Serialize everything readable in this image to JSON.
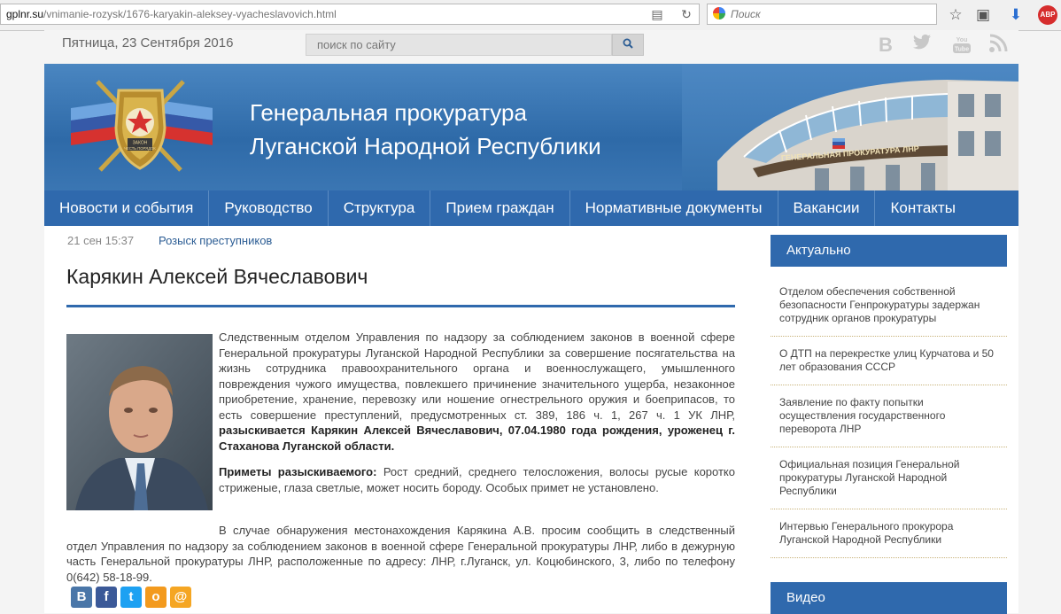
{
  "browser": {
    "url_domain": "gplnr.su",
    "url_path": "/vnimanie-rozysk/1676-karyakin-aleksey-vyacheslavovich.html",
    "search_placeholder": "Поиск",
    "abp_label": "ABP"
  },
  "header": {
    "date": "Пятница, 23 Сентября 2016",
    "search_placeholder": "поиск по сайту",
    "social": [
      "В",
      "twitter",
      "YouTube",
      "rss"
    ]
  },
  "banner": {
    "title_line1": "Генеральная прокуратура",
    "title_line2": "Луганской Народной Республики",
    "emblem_text": "ЗАКОН ЧЕСТЬ ПОРЯДОК",
    "building_sign": "ГЕНЕРАЛЬНАЯ ПРОКУРАТУРА ЛНР"
  },
  "nav": {
    "items": [
      "Новости и события",
      "Руководство",
      "Структура",
      "Прием граждан",
      "Нормативные документы",
      "Вакансии",
      "Контакты"
    ]
  },
  "article": {
    "date": "21 сен 15:37",
    "category": "Розыск преступников",
    "title": "Карякин Алексей Вячеславович",
    "p1_text": "Следственным отделом Управления по надзору за соблюдением законов в военной сфере Генеральной прокуратуры Луганской Народной Республики за совершение посягательства на жизнь сотрудника правоохранительного органа и военнослужащего, умышленного повреждения чужого имущества, повлекшего причинение значительного ущерба, незаконное приобретение, хранение, перевозку или ношение огнестрельного оружия и боеприпасов, то есть совершение преступлений, предусмотренных ст. 389, 186 ч. 1, 267 ч. 1 УК ЛНР, ",
    "p1_bold": "разыскивается Карякин Алексей Вячеславович, 07.04.1980 года рождения, уроженец г. Стаханова Луганской области.",
    "p2_label": "Приметы разыскиваемого:",
    "p2_text": " Рост средний, среднего телосложения, волосы русые коротко стриженые, глаза светлые, может носить бороду. Особых примет не установлено.",
    "p3_text": "В случае обнаружения местонахождения Карякина А.В. просим сообщить в следственный отдел Управления по надзору за соблюдением законов в военной сфере Генеральной прокуратуры ЛНР, либо в дежурную часть Генеральной прокуратуры ЛНР, расположенные по адресу: ЛНР, г.Луганск, ул. Коцюбинского, 3, либо  по телефону 0(642) 58-18-99."
  },
  "share": {
    "vk": "B",
    "fb": "f",
    "tw": "t",
    "ok": "o",
    "mail": "@"
  },
  "sidebar": {
    "heading": "Актуально",
    "items": [
      "Отделом обеспечения собственной безопасности Генпрокуратуры задержан сотрудник органов прокуратуры",
      "О ДТП на перекрестке улиц Курчатова и 50 лет образования СССР",
      "Заявление по факту попытки осуществления государственного переворота ЛНР",
      "Официальная позиция Генеральной прокуратуры Луганской Народной Республики",
      "Интервью Генерального прокурора Луганской Народной Республики"
    ],
    "heading2": "Видео"
  }
}
